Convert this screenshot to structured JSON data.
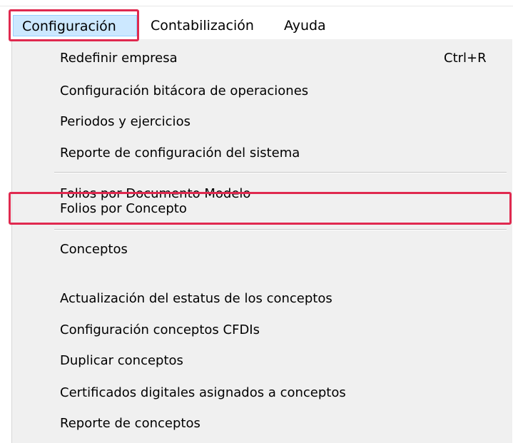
{
  "menubar": {
    "items": [
      {
        "label": "Configuración",
        "active": true
      },
      {
        "label": "Contabilización",
        "active": false
      },
      {
        "label": "Ayuda",
        "active": false
      }
    ]
  },
  "dropdown": {
    "group1": [
      {
        "label": "Redefinir empresa",
        "shortcut": "Ctrl+R"
      },
      {
        "label": "Configuración bitácora de operaciones"
      },
      {
        "label": "Periodos y ejercicios"
      },
      {
        "label": "Reporte de configuración del sistema"
      }
    ],
    "group2": [
      {
        "label": "Folios por Documento Modelo"
      },
      {
        "label": "Folios por Concepto",
        "highlighted": true
      }
    ],
    "group3": [
      {
        "label": "Conceptos"
      },
      {
        "label": "Actualización del estatus de los conceptos"
      },
      {
        "label": "Configuración conceptos CFDIs"
      },
      {
        "label": "Duplicar conceptos"
      },
      {
        "label": "Certificados digitales asignados a conceptos"
      },
      {
        "label": "Reporte de conceptos"
      }
    ]
  },
  "colors": {
    "annotation_box": "#e0294f",
    "menu_background": "#f0f0f0",
    "active_menubar_item": "#cce8ff"
  }
}
